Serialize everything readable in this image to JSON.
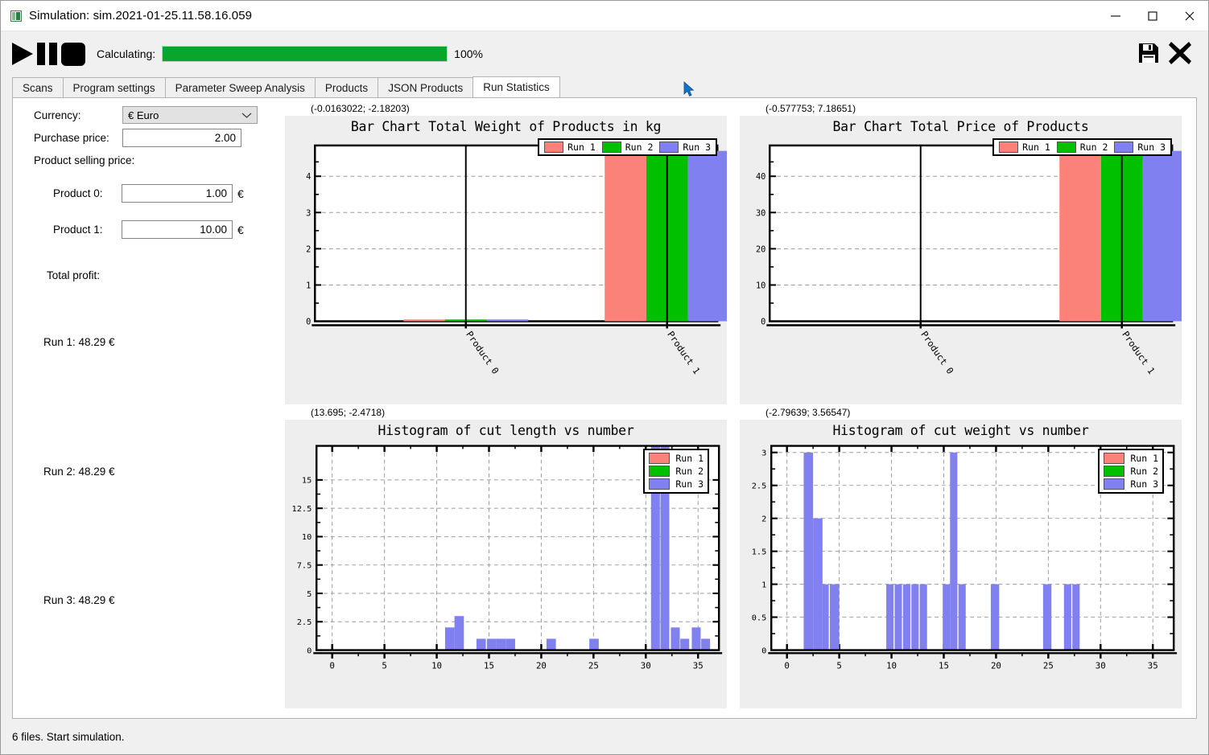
{
  "window": {
    "title": "Simulation: sim.2021-01-25.11.58.16.059",
    "app_icon": "app-icon",
    "minimize": "minimize-icon",
    "maximize": "maximize-icon",
    "close": "close-icon"
  },
  "toolbar": {
    "play": "play-icon",
    "pause": "pause-icon",
    "stop": "stop-icon",
    "calculating_label": "Calculating:",
    "progress_percent": 100,
    "progress_text": "100%",
    "progress_color": "#0aa52b",
    "save_icon": "save-icon",
    "close_icon": "bold-x-icon"
  },
  "tabs": [
    {
      "label": "Scans",
      "active": false
    },
    {
      "label": "Program settings",
      "active": false
    },
    {
      "label": "Parameter Sweep Analysis",
      "active": false
    },
    {
      "label": "Products",
      "active": false
    },
    {
      "label": "JSON Products",
      "active": false
    },
    {
      "label": "Run Statistics",
      "active": true
    }
  ],
  "sidebar": {
    "currency_label": "Currency:",
    "currency_value": "€ Euro",
    "currency_options": [
      "€ Euro"
    ],
    "purchase_price_label": "Purchase price:",
    "purchase_price_value": "2.00",
    "product_selling_price_label": "Product selling price:",
    "products": [
      {
        "label": "Product 0:",
        "value": "1.00",
        "unit": "€"
      },
      {
        "label": "Product 1:",
        "value": "10.00",
        "unit": "€"
      }
    ],
    "total_profit_label": "Total profit:",
    "runs": [
      "Run 1: 48.29 €",
      "Run 2: 48.29 €",
      "Run 3: 48.29 €"
    ]
  },
  "statusbar": {
    "text": "6 files. Start simulation."
  },
  "legend_colors": {
    "run1": "#fa8278",
    "run2": "#00c000",
    "run3": "#8080f0"
  },
  "chart_data": [
    {
      "id": "bar-weight",
      "type": "bar",
      "coord_readout": "(-0.0163022; -2.18203)",
      "title": "Bar Chart Total Weight of Products in kg",
      "categories": [
        "Product 0",
        "Product 1"
      ],
      "series": [
        {
          "name": "Run 1",
          "color": "#fa8278",
          "values": [
            0.05,
            4.7
          ]
        },
        {
          "name": "Run 2",
          "color": "#00c000",
          "values": [
            0.05,
            4.7
          ]
        },
        {
          "name": "Run 3",
          "color": "#8080f0",
          "values": [
            0.05,
            4.7
          ]
        }
      ],
      "ylim": [
        0,
        4.85
      ],
      "yticks": [
        0,
        1,
        2,
        3,
        4
      ],
      "ytick_labels": [
        "0",
        "1",
        "2",
        "3",
        "4"
      ],
      "xlabel": "",
      "ylabel": "",
      "grid": true,
      "legend_position": "top-right"
    },
    {
      "id": "bar-price",
      "type": "bar",
      "coord_readout": "(-0.577753; 7.18651)",
      "title": "Bar Chart Total Price of Products",
      "categories": [
        "Product 0",
        "Product 1"
      ],
      "series": [
        {
          "name": "Run 1",
          "color": "#fa8278",
          "values": [
            0.0,
            47.0
          ]
        },
        {
          "name": "Run 2",
          "color": "#00c000",
          "values": [
            0.0,
            47.0
          ]
        },
        {
          "name": "Run 3",
          "color": "#8080f0",
          "values": [
            0.0,
            47.0
          ]
        }
      ],
      "ylim": [
        0,
        48.5
      ],
      "yticks": [
        0,
        10,
        20,
        30,
        40
      ],
      "ytick_labels": [
        "0",
        "10",
        "20",
        "30",
        "40"
      ],
      "xlabel": "",
      "ylabel": "",
      "grid": true,
      "legend_position": "top-right"
    },
    {
      "id": "hist-cut-length",
      "type": "bar",
      "coord_readout": "(13.695; -2.4718)",
      "title": "Histogram of cut length vs number",
      "xlim": [
        -1.5,
        37
      ],
      "ylim": [
        0,
        18
      ],
      "xticks": [
        0,
        5,
        10,
        15,
        20,
        25,
        30,
        35
      ],
      "xtick_labels": [
        "0",
        "5",
        "10",
        "15",
        "20",
        "25",
        "30",
        "35"
      ],
      "yticks": [
        0,
        2.5,
        5,
        7.5,
        10,
        12.5,
        15
      ],
      "ytick_labels": [
        "0",
        "2.5",
        "5",
        "7.5",
        "10",
        "12.5",
        "15"
      ],
      "series": [
        {
          "name": "Run 1",
          "color": "#fa8278",
          "values": []
        },
        {
          "name": "Run 2",
          "color": "#00c000",
          "values": []
        },
        {
          "name": "Run 3",
          "color": "#8080f0",
          "bins": [
            {
              "x": 10.8,
              "width": 0.9,
              "count": 2
            },
            {
              "x": 11.7,
              "width": 0.9,
              "count": 3
            },
            {
              "x": 13.8,
              "width": 0.9,
              "count": 1
            },
            {
              "x": 14.8,
              "width": 0.9,
              "count": 1
            },
            {
              "x": 15.7,
              "width": 0.9,
              "count": 1
            },
            {
              "x": 16.6,
              "width": 0.9,
              "count": 1
            },
            {
              "x": 20.5,
              "width": 0.9,
              "count": 1
            },
            {
              "x": 24.6,
              "width": 0.9,
              "count": 1
            },
            {
              "x": 30.5,
              "width": 0.85,
              "count": 18
            },
            {
              "x": 31.4,
              "width": 0.85,
              "count": 18
            },
            {
              "x": 32.4,
              "width": 0.85,
              "count": 2
            },
            {
              "x": 33.3,
              "width": 0.85,
              "count": 1
            },
            {
              "x": 34.4,
              "width": 0.85,
              "count": 2
            },
            {
              "x": 35.3,
              "width": 0.85,
              "count": 1
            }
          ]
        }
      ],
      "grid": true,
      "legend_position": "top-right"
    },
    {
      "id": "hist-cut-weight",
      "type": "bar",
      "coord_readout": "(-2.79639; 3.56547)",
      "title": "Histogram of cut weight vs number",
      "xlim": [
        -1.5,
        37
      ],
      "ylim": [
        0,
        3.1
      ],
      "xticks": [
        0,
        5,
        10,
        15,
        20,
        25,
        30,
        35
      ],
      "xtick_labels": [
        "0",
        "5",
        "10",
        "15",
        "20",
        "25",
        "30",
        "35"
      ],
      "yticks": [
        0,
        0.5,
        1,
        1.5,
        2,
        2.5,
        3
      ],
      "ytick_labels": [
        "0",
        "0.5",
        "1",
        "1.5",
        "2",
        "2.5",
        "3"
      ],
      "series": [
        {
          "name": "Run 1",
          "color": "#fa8278",
          "values": []
        },
        {
          "name": "Run 2",
          "color": "#00c000",
          "values": []
        },
        {
          "name": "Run 3",
          "color": "#8080f0",
          "bins": [
            {
              "x": 1.6,
              "width": 0.9,
              "count": 3
            },
            {
              "x": 2.5,
              "width": 0.9,
              "count": 2
            },
            {
              "x": 3.4,
              "width": 0.6,
              "count": 1
            },
            {
              "x": 4.1,
              "width": 0.9,
              "count": 1
            },
            {
              "x": 9.5,
              "width": 0.7,
              "count": 1
            },
            {
              "x": 10.3,
              "width": 0.7,
              "count": 1
            },
            {
              "x": 11.1,
              "width": 0.7,
              "count": 1
            },
            {
              "x": 11.9,
              "width": 0.7,
              "count": 1
            },
            {
              "x": 12.7,
              "width": 0.7,
              "count": 1
            },
            {
              "x": 14.9,
              "width": 0.7,
              "count": 1
            },
            {
              "x": 15.6,
              "width": 0.7,
              "count": 3
            },
            {
              "x": 16.4,
              "width": 0.7,
              "count": 1
            },
            {
              "x": 19.5,
              "width": 0.8,
              "count": 1
            },
            {
              "x": 24.5,
              "width": 0.8,
              "count": 1
            },
            {
              "x": 26.5,
              "width": 0.7,
              "count": 1
            },
            {
              "x": 27.3,
              "width": 0.7,
              "count": 1
            }
          ]
        }
      ],
      "grid": true,
      "legend_position": "top-right"
    }
  ]
}
